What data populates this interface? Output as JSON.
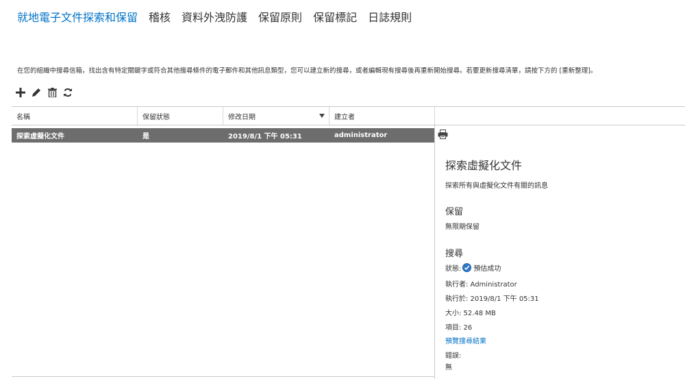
{
  "nav": {
    "tabs": [
      {
        "label": "就地電子文件探索和保留",
        "active": true
      },
      {
        "label": "稽核"
      },
      {
        "label": "資料外洩防護"
      },
      {
        "label": "保留原則"
      },
      {
        "label": "保留標記"
      },
      {
        "label": "日誌規則"
      }
    ]
  },
  "intro_text": "在您的組織中搜尋信箱，找出含有特定關鍵字或符合其他搜尋條件的電子郵件和其他訊息類型，您可以建立新的搜尋，或者編輯現有搜尋後再重新開始搜尋。若要更新搜尋清單，請按下方的 [重新整理]。",
  "toolbar": {
    "icons": [
      "plus-icon",
      "pencil-icon",
      "trash-icon",
      "refresh-icon"
    ]
  },
  "grid": {
    "columns": [
      "名稱",
      "保留狀態",
      "修改日期",
      "建立者"
    ],
    "rows": [
      {
        "name": "探索虛擬化文件",
        "hold": "是",
        "modified": "2019/8/1 下午 05:31",
        "creator": "administrator"
      }
    ]
  },
  "detail": {
    "title": "探索虛擬化文件",
    "description": "探索所有與虛擬化文件有關的訊息",
    "hold_heading": "保留",
    "hold_value": "無限期保留",
    "search_heading": "搜尋",
    "status_label": "狀態:",
    "status_value": "預估成功",
    "run_by": "執行者: Administrator",
    "run_at": "執行於: 2019/8/1 下午 05:31",
    "size": "大小: 52.48 MB",
    "items": "項目: 26",
    "preview_link": "預覽搜尋結果",
    "errors_label": "錯誤:",
    "errors_value": "無"
  },
  "colors": {
    "accent": "#0072c6",
    "selected_row": "#6d6d6d"
  }
}
